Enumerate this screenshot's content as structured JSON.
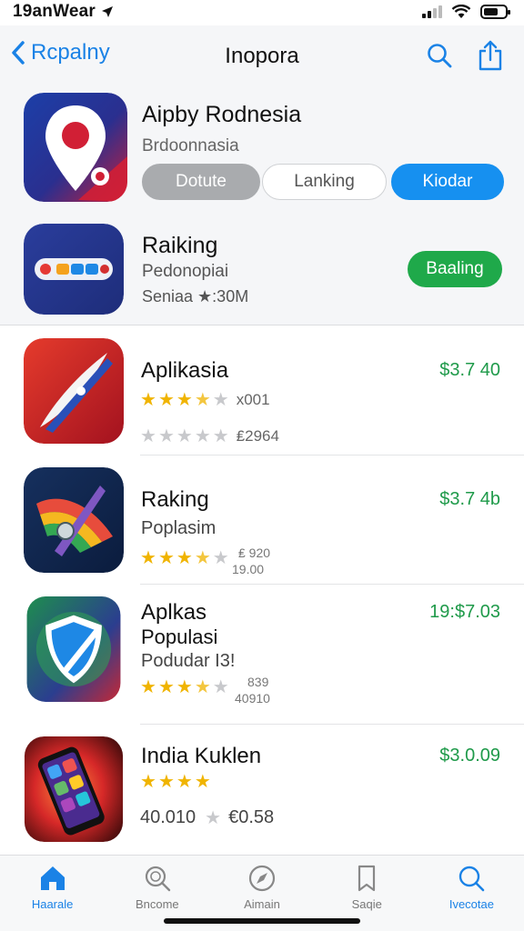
{
  "status_bar": {
    "time": "19anWear"
  },
  "nav": {
    "back_label": "Rcpalny",
    "title": "Inopora"
  },
  "featured": [
    {
      "name": "Aipby Rodnesia",
      "subtitle": "Brdoonnasia",
      "buttons": [
        "Dotute",
        "Lanking",
        "Kiodar"
      ]
    },
    {
      "name": "Raiking",
      "subtitle": "Pedonopiai",
      "meta": "Seniaa ★:30M",
      "button": "Baaling"
    }
  ],
  "list": [
    {
      "name": "Aplikasia",
      "price": "$3.7 40",
      "rating_a": 3.5,
      "count_a": "x001",
      "rating_b": 0,
      "count_b": "₤2964"
    },
    {
      "name": "Raking",
      "subtitle": "Poplasim",
      "price": "$3.7 4b",
      "rating": 3.5,
      "count_top": "₤ 920",
      "count_bottom": "19.00"
    },
    {
      "name": "Aplkas",
      "subtitle": "Populasi",
      "subtitle2": "Podudar I3!",
      "price": "19:$7.03",
      "rating": 3.5,
      "count_top": "839",
      "count_bottom": "40910"
    },
    {
      "name": "India Kuklen",
      "price": "$3.0.09",
      "rating": 4,
      "meta": "40.010",
      "meta2": "€0.58"
    }
  ],
  "tabs": [
    {
      "label": "Haarale",
      "icon": "home-icon",
      "active": true
    },
    {
      "label": "Bncome",
      "icon": "search-icon",
      "active": false
    },
    {
      "label": "Aimain",
      "icon": "compass-icon",
      "active": false
    },
    {
      "label": "Saqie",
      "icon": "bookmark-icon",
      "active": false
    },
    {
      "label": "Ivecotae",
      "icon": "magnifier-icon",
      "active": false
    }
  ],
  "colors": {
    "accent": "#1a82e6",
    "price": "#1f9a4a",
    "button_green": "#1fa94a",
    "button_blue": "#1690f0",
    "star": "#f0b400"
  }
}
